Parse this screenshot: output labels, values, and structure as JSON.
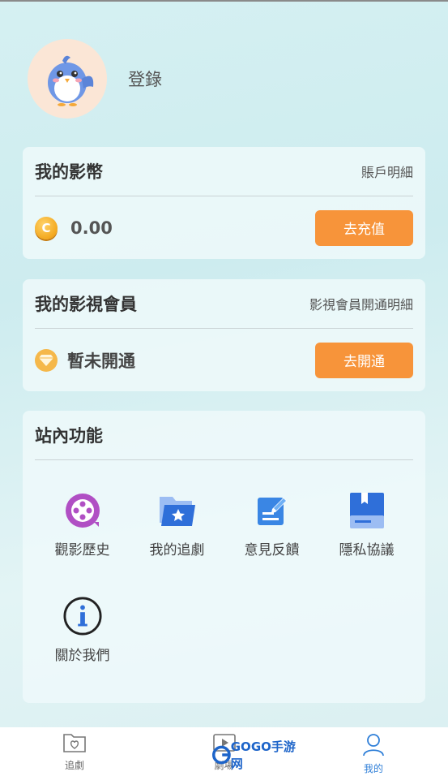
{
  "header": {
    "login_label": "登錄"
  },
  "coins": {
    "title": "我的影幣",
    "detail_link": "賬戶明細",
    "amount": "0.00",
    "button": "去充值"
  },
  "vip": {
    "title": "我的影視會員",
    "detail_link": "影視會員開通明細",
    "status": "暫未開通",
    "button": "去開通"
  },
  "features": {
    "title": "站內功能",
    "items": [
      {
        "label": "觀影歷史",
        "icon": "film-reel-icon"
      },
      {
        "label": "我的追劇",
        "icon": "star-folder-icon"
      },
      {
        "label": "意見反饋",
        "icon": "feedback-edit-icon"
      },
      {
        "label": "隱私協議",
        "icon": "privacy-book-icon"
      },
      {
        "label": "關於我們",
        "icon": "info-icon"
      }
    ]
  },
  "tabbar": {
    "tabs": [
      {
        "label": "追劇",
        "icon": "heart-folder-icon"
      },
      {
        "label": "劇場",
        "icon": "play-icon"
      },
      {
        "label": "我的",
        "icon": "person-icon"
      }
    ]
  },
  "watermark": {
    "text": "GOGO手游网"
  },
  "colors": {
    "accent_orange": "#f7943a",
    "active_tab": "#2f7fd8",
    "coin_gold": "#f3a81e"
  }
}
